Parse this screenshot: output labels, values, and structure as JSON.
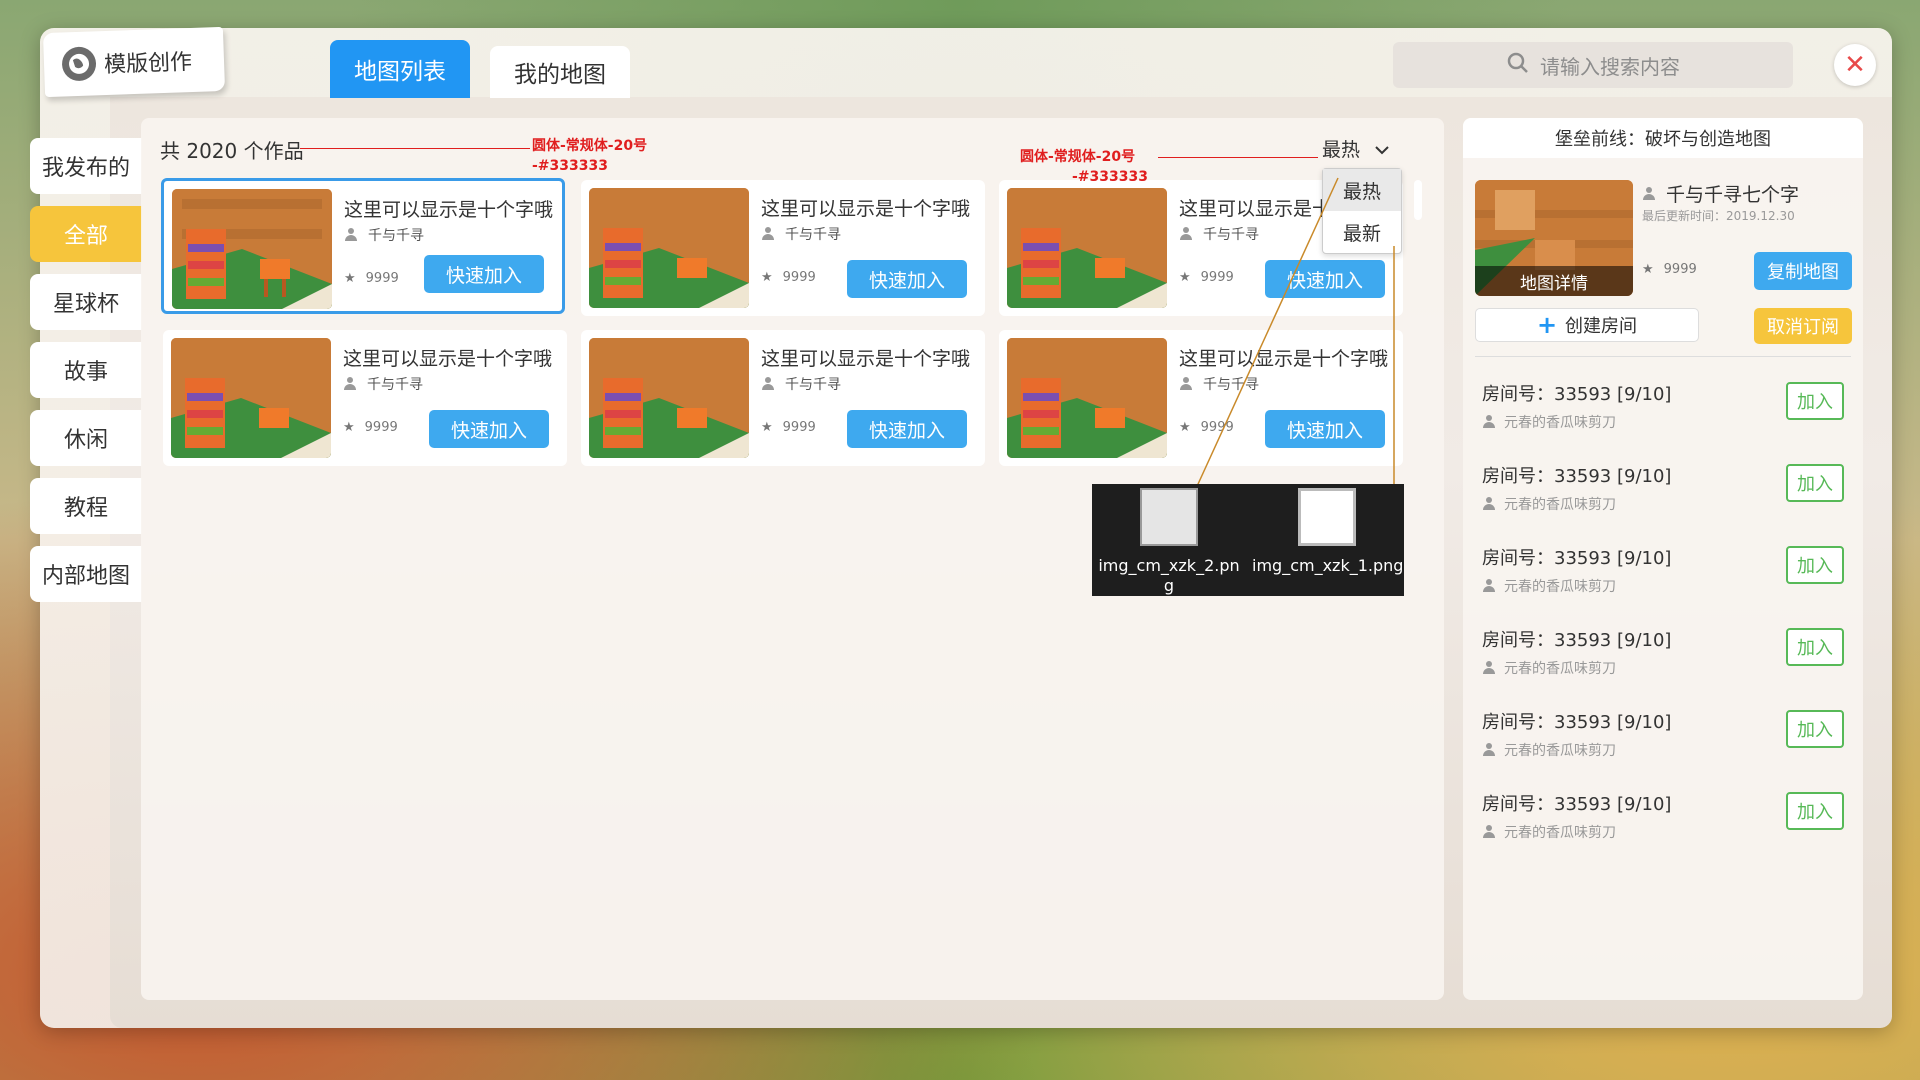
{
  "header": {
    "title": "模版创作",
    "tabs": [
      {
        "label": "地图列表",
        "active": true
      },
      {
        "label": "我的地图",
        "active": false
      }
    ],
    "search_placeholder": "请输入搜索内容"
  },
  "sidebar": {
    "items": [
      {
        "label": "我发布的",
        "active": false
      },
      {
        "label": "全部",
        "active": true
      },
      {
        "label": "星球杯",
        "active": false
      },
      {
        "label": "故事",
        "active": false
      },
      {
        "label": "休闲",
        "active": false
      },
      {
        "label": "教程",
        "active": false
      },
      {
        "label": "内部地图",
        "active": false
      }
    ]
  },
  "main": {
    "count_text": "共 2020 个作品",
    "sort_current": "最热",
    "sort_options": [
      "最热",
      "最新"
    ],
    "cards": [
      {
        "title": "这里可以显示是十个字哦",
        "author": "千与千寻",
        "rating": "9999",
        "button": "快速加入",
        "selected": true
      },
      {
        "title": "这里可以显示是十个字哦",
        "author": "千与千寻",
        "rating": "9999",
        "button": "快速加入"
      },
      {
        "title": "这里可以显示是十个字哦",
        "author": "千与千寻",
        "rating": "9999",
        "button": "快速加入"
      },
      {
        "title": "这里可以显示是十个字哦",
        "author": "千与千寻",
        "rating": "9999",
        "button": "快速加入"
      },
      {
        "title": "这里可以显示是十个字哦",
        "author": "千与千寻",
        "rating": "9999",
        "button": "快速加入"
      },
      {
        "title": "这里可以显示是十个字哦",
        "author": "千与千寻",
        "rating": "9999",
        "button": "快速加入"
      }
    ]
  },
  "annotations": [
    {
      "line1": "圆体-常规体-20号",
      "line2": "-#333333"
    },
    {
      "line1": "圆体-常规体-20号",
      "line2": "-#333333"
    }
  ],
  "assets": [
    {
      "name": "img_cm_xzk_2.png"
    },
    {
      "name": "img_cm_xzk_1.png"
    }
  ],
  "detail": {
    "header": "堡垒前线：破坏与创造地图",
    "thumb_label": "地图详情",
    "author": "千与千寻七个字",
    "updated": "最后更新时间：2019.12.30",
    "rating": "9999",
    "copy_button": "复制地图",
    "create_room": "创建房间",
    "cancel_button": "取消订阅",
    "rooms": [
      {
        "no": "房间号：33593 [9/10]",
        "user": "元春的香瓜味剪刀",
        "button": "加入"
      },
      {
        "no": "房间号：33593 [9/10]",
        "user": "元春的香瓜味剪刀",
        "button": "加入"
      },
      {
        "no": "房间号：33593 [9/10]",
        "user": "元春的香瓜味剪刀",
        "button": "加入"
      },
      {
        "no": "房间号：33593 [9/10]",
        "user": "元春的香瓜味剪刀",
        "button": "加入"
      },
      {
        "no": "房间号：33593 [9/10]",
        "user": "元春的香瓜味剪刀",
        "button": "加入"
      },
      {
        "no": "房间号：33593 [9/10]",
        "user": "元春的香瓜味剪刀",
        "button": "加入"
      }
    ]
  },
  "colors": {
    "primary_blue": "#2196f3",
    "button_blue": "#3ea9ef",
    "accent_yellow": "#f6c53c",
    "join_green": "#57b957",
    "close_red": "#e84a4a",
    "annotation_red": "#e01e1e"
  },
  "icons": {
    "logo": "globe-logo-icon",
    "search": "search-icon",
    "close": "close-icon",
    "sort": "chevron-down-icon",
    "author": "person-icon",
    "rating": "star-icon",
    "create": "plus-icon"
  }
}
